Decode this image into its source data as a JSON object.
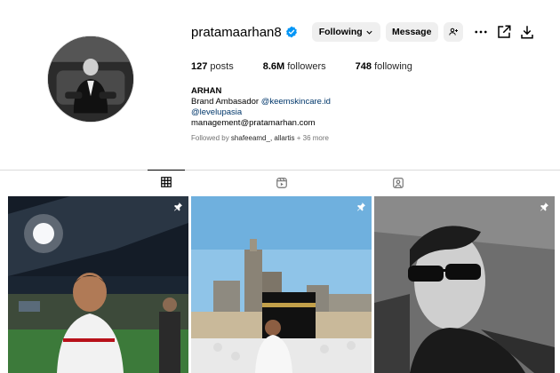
{
  "profile": {
    "username": "pratamaarhan8",
    "verified": true,
    "following_button_label": "Following",
    "message_button_label": "Message"
  },
  "stats": {
    "posts_count": "127",
    "posts_label": "posts",
    "followers_count": "8.6M",
    "followers_label": "followers",
    "following_count": "748",
    "following_label": "following"
  },
  "bio": {
    "name": "ARHAN",
    "line1_prefix": "Brand Ambasador ",
    "line1_mention": "@keemskincare.id",
    "line2_mention": "@levelupasia",
    "line3": "management@pratamarhan.com",
    "followed_by_prefix": "Followed by ",
    "followed_by_users": "shafeeamd_, allartis",
    "followed_by_suffix": " + 36 more"
  },
  "tabs": [
    {
      "name": "posts",
      "icon": "grid-icon",
      "active": true
    },
    {
      "name": "reels",
      "icon": "reels-icon",
      "active": false
    },
    {
      "name": "tagged",
      "icon": "tagged-icon",
      "active": false
    }
  ],
  "posts": [
    {
      "icon": "pin-icon",
      "pinned": true,
      "subject": "stadium-football-portrait"
    },
    {
      "icon": "pin-icon",
      "pinned": true,
      "subject": "mecca-kaaba-photo"
    },
    {
      "icon": "pin-icon",
      "pinned": true,
      "subject": "black-and-white-sunglasses-portrait"
    }
  ],
  "colors": {
    "verified_blue": "#0095f6",
    "link_blue": "#00376b",
    "button_gray": "#efefef",
    "divider": "#dbdbdb"
  }
}
